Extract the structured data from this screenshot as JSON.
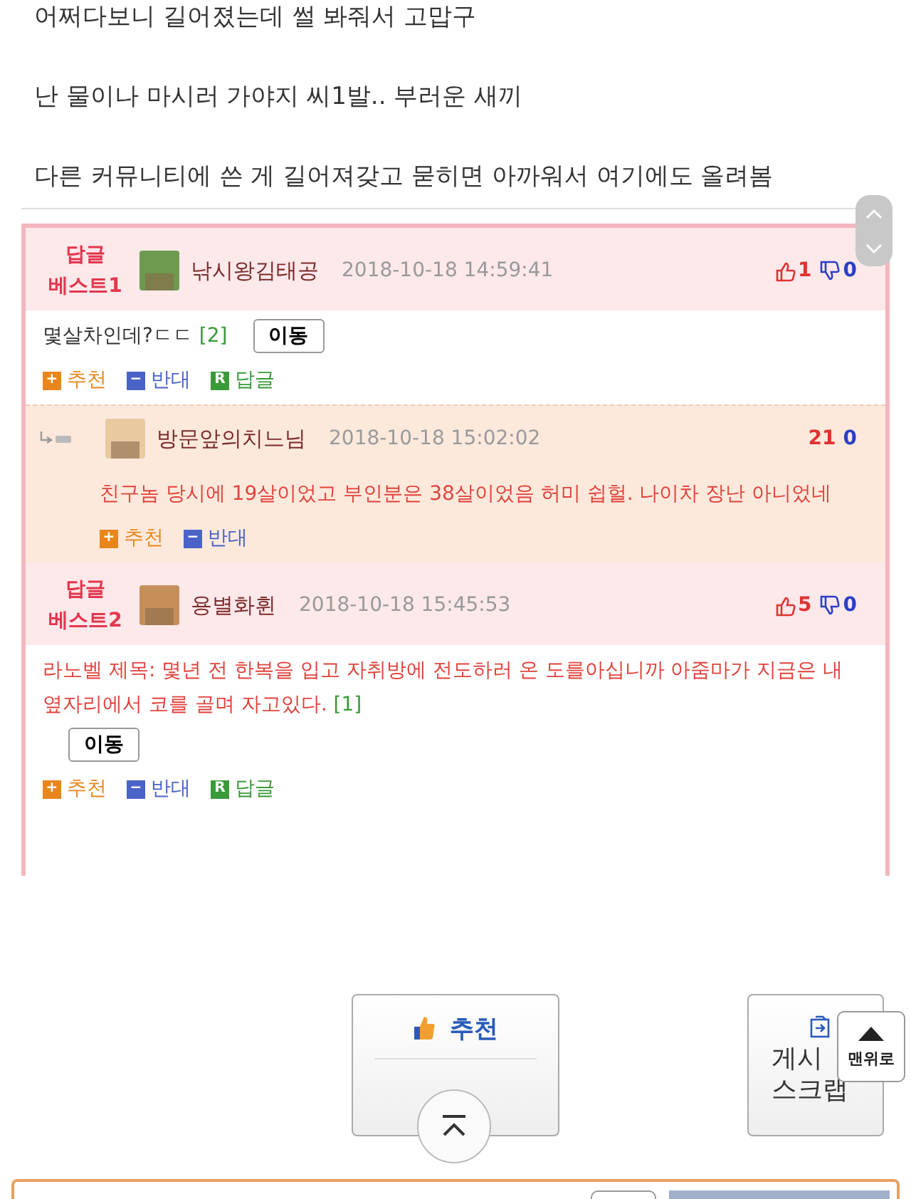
{
  "post_lines": [
    "어쩌다보니 길어졌는데 썰 봐줘서 고맙구",
    "난 물이나 마시러 가야지 씨1발.. 부러운 새끼",
    "다른 커뮤니티에 쓴 게 길어져갖고 묻히면 아까워서 여기에도 올려봄"
  ],
  "comments": [
    {
      "kind": "best",
      "badge_lines": [
        "답글",
        "베스트1"
      ],
      "author": "낚시왕김태공",
      "date": "2018-10-18 14:59:41",
      "thumb_icons": true,
      "up": "1",
      "down": "0",
      "red_text": false,
      "body": "몇살차인데?ㄷㄷ",
      "reply_count": "[2]",
      "move_button": "이동",
      "actions": [
        {
          "kind": "up",
          "glyph": "+",
          "label": "추천"
        },
        {
          "kind": "down",
          "glyph": "−",
          "label": "반대"
        },
        {
          "kind": "reply",
          "glyph": "R",
          "label": "답글"
        }
      ]
    },
    {
      "kind": "reply",
      "author": "방문앞의치느님",
      "date": "2018-10-18 15:02:02",
      "thumb_icons": false,
      "up": "21",
      "down": "0",
      "red_text": true,
      "body": "친구놈 당시에 19살이었고 부인분은 38살이었음 허미 쉽헐. 나이차 장난 아니었네",
      "actions": [
        {
          "kind": "up",
          "glyph": "+",
          "label": "추천"
        },
        {
          "kind": "down",
          "glyph": "−",
          "label": "반대"
        }
      ]
    },
    {
      "kind": "best",
      "badge_lines": [
        "답글",
        "베스트2"
      ],
      "author": "용별화휜",
      "date": "2018-10-18 15:45:53",
      "thumb_icons": true,
      "up": "5",
      "down": "0",
      "red_text": true,
      "body": "라노벨 제목: 몇년 전 한복을 입고 자취방에 전도하러 온 도를아십니까 아줌마가 지금은 내 옆자리에서 코를 골며 자고있다.",
      "reply_count": "[1]",
      "move_button": "이동",
      "actions": [
        {
          "kind": "up",
          "glyph": "+",
          "label": "추천"
        },
        {
          "kind": "down",
          "glyph": "−",
          "label": "반대"
        },
        {
          "kind": "reply",
          "glyph": "R",
          "label": "답글"
        }
      ]
    }
  ],
  "recommend_button": {
    "label": "추천"
  },
  "scrap_button": {
    "lines": [
      "게시",
      "스크랩"
    ]
  },
  "top_button": {
    "label": "맨위로"
  }
}
